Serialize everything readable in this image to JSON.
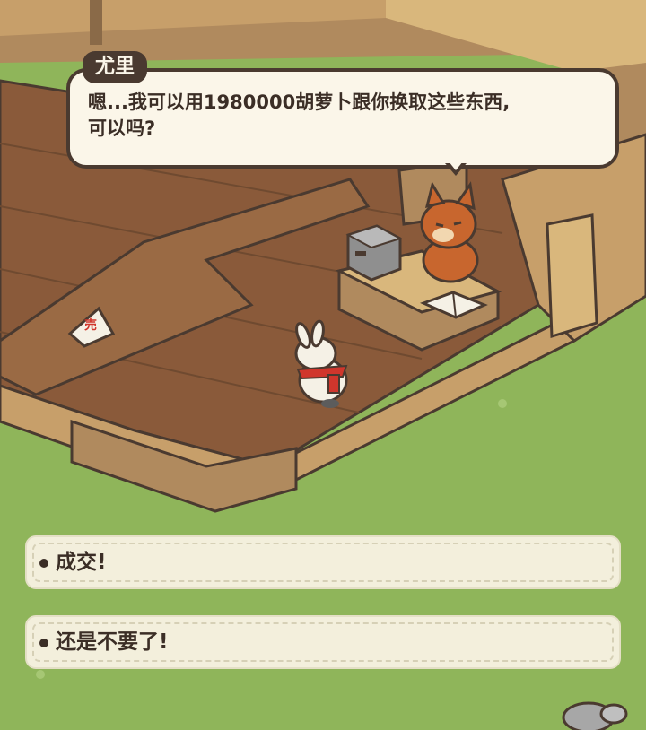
{
  "dialogue": {
    "speaker": "尤里",
    "text_line1": "嗯...我可以用1980000胡萝卜跟你换取这些东西,",
    "text_line2": "可以吗?"
  },
  "scene": {
    "sale_sign": "売"
  },
  "choices": [
    {
      "label": "成交!"
    },
    {
      "label": "还是不要了!"
    }
  ],
  "colors": {
    "grass": "#8fb55a",
    "floor": "#8a5a3a",
    "outline": "#4a3a30",
    "bubble": "#fbf6e9",
    "choice_bg": "#f3efdc"
  }
}
